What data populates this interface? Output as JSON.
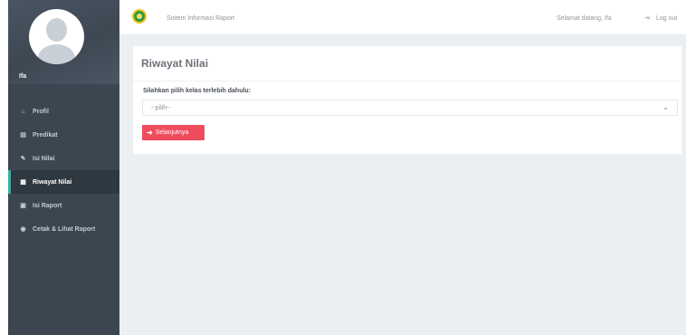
{
  "sidebar": {
    "profile_name": "Ifa",
    "items": [
      {
        "label": "Profil",
        "icon": "home-icon",
        "glyph": "⌂",
        "active": false
      },
      {
        "label": "Predikat",
        "icon": "list-icon",
        "glyph": "▤",
        "active": false
      },
      {
        "label": "Isi Nilai",
        "icon": "pencil-icon",
        "glyph": "✎",
        "active": false
      },
      {
        "label": "Riwayat Nilai",
        "icon": "table-icon",
        "glyph": "▦",
        "active": true
      },
      {
        "label": "Isi Raport",
        "icon": "book-icon",
        "glyph": "▣",
        "active": false
      },
      {
        "label": "Cetak & Lihat Raport",
        "icon": "eye-icon",
        "glyph": "◉",
        "active": false
      }
    ]
  },
  "header": {
    "app_title": "Sistem Informasi Raport",
    "welcome": "Selamat datang, Ifa",
    "logout_label": "Log out",
    "logout_icon": "sign-out-icon"
  },
  "main": {
    "title": "Riwayat Nilai",
    "field_label": "Silahkan pilih kelas terlebih dahulu:",
    "select_value": "--pilih--",
    "next_button": "Selanjutnya"
  },
  "colors": {
    "sidebar_bg": "#3b4651",
    "active_accent": "#2bb3a4",
    "button": "#ef4c5e",
    "content_bg": "#eceff2"
  }
}
